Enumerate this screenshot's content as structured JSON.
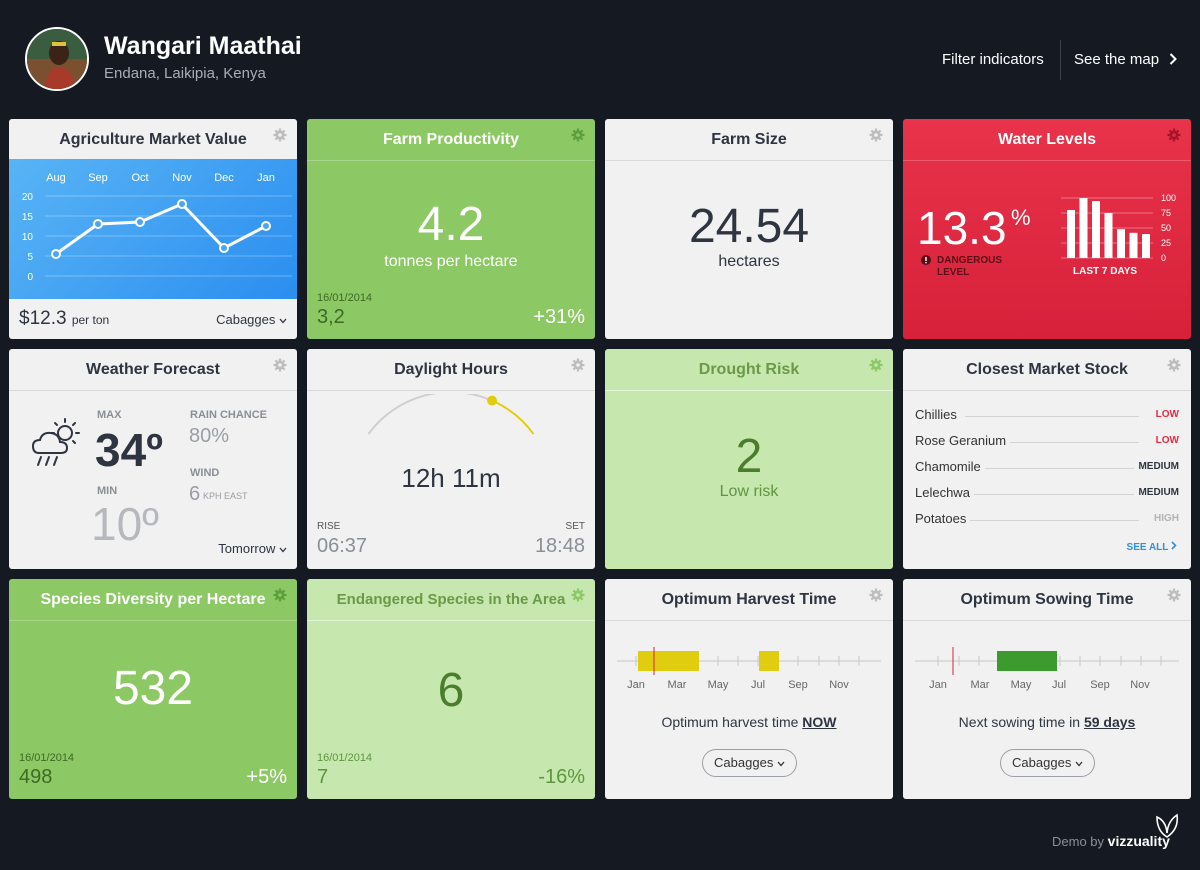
{
  "user": {
    "name": "Wangari Maathai",
    "location": "Endana, Laikipia, Kenya"
  },
  "nav": {
    "filter_label": "Filter indicators",
    "map_label": "See the map"
  },
  "cards": {
    "market_value": {
      "title": "Agriculture Market Value",
      "price": "$12.3",
      "unit": "per ton",
      "crop": "Cabagges",
      "chart_data": {
        "type": "line",
        "categories": [
          "Aug",
          "Sep",
          "Oct",
          "Nov",
          "Dec",
          "Jan"
        ],
        "values": [
          5.5,
          13,
          13.5,
          18,
          7,
          12.5
        ],
        "yticks": [
          "20",
          "15",
          "10",
          "5",
          "0"
        ],
        "ylim": [
          0,
          20
        ]
      }
    },
    "farm_productivity": {
      "title": "Farm Productivity",
      "value": "4.2",
      "unit": "tonnes per hectare",
      "date": "16/01/2014",
      "prev": "3,2",
      "change": "+31%"
    },
    "farm_size": {
      "title": "Farm Size",
      "value": "24.54",
      "unit": "hectares"
    },
    "water_levels": {
      "title": "Water Levels",
      "value": "13.3",
      "pct": "%",
      "warning": "DANGEROUS LEVEL",
      "chart_label": "LAST 7 DAYS",
      "chart_data": {
        "type": "bar",
        "values": [
          80,
          100,
          95,
          75,
          48,
          42,
          40
        ],
        "yticks": [
          "100",
          "75",
          "50",
          "25",
          "0"
        ],
        "ylim": [
          0,
          100
        ]
      }
    },
    "weather": {
      "title": "Weather Forecast",
      "max_label": "MAX",
      "max": "34º",
      "min_label": "MIN",
      "min": "10º",
      "rain_label": "RAIN CHANCE",
      "rain": "80%",
      "wind_label": "WIND",
      "wind_speed": "6",
      "wind_unit": "KPH EAST",
      "day": "Tomorrow"
    },
    "daylight": {
      "title": "Daylight Hours",
      "value": "12h 11m",
      "rise_label": "RISE",
      "rise": "06:37",
      "set_label": "SET",
      "set": "18:48",
      "progress": 0.72
    },
    "drought": {
      "title": "Drought Risk",
      "value": "2",
      "label": "Low risk"
    },
    "market_stock": {
      "title": "Closest Market Stock",
      "items": [
        {
          "name": "Chillies",
          "level": "LOW",
          "color": "#e02e44"
        },
        {
          "name": "Rose Geranium",
          "level": "LOW",
          "color": "#e02e44"
        },
        {
          "name": "Chamomile",
          "level": "MEDIUM",
          "color": "#2e3440"
        },
        {
          "name": "Lelechwa",
          "level": "MEDIUM",
          "color": "#2e3440"
        },
        {
          "name": "Potatoes",
          "level": "HIGH",
          "color": "#b3b3b3"
        }
      ],
      "see_all": "SEE ALL"
    },
    "species": {
      "title": "Species Diversity per Hectare",
      "value": "532",
      "date": "16/01/2014",
      "prev": "498",
      "change": "+5%"
    },
    "endangered": {
      "title": "Endangered Species in the Area",
      "value": "6",
      "date": "16/01/2014",
      "prev": "7",
      "change": "-16%"
    },
    "harvest": {
      "title": "Optimum Harvest Time",
      "months": [
        "Jan",
        "Mar",
        "May",
        "Jul",
        "Sep",
        "Nov"
      ],
      "text": "Optimum harvest time",
      "highlight": "NOW",
      "crop": "Cabagges",
      "color": "#e1cd10"
    },
    "sowing": {
      "title": "Optimum Sowing Time",
      "months": [
        "Jan",
        "Mar",
        "May",
        "Jul",
        "Sep",
        "Nov"
      ],
      "text": "Next sowing time in",
      "highlight": "59 days",
      "crop": "Cabagges",
      "color": "#3b9b2c"
    }
  },
  "footer": {
    "demo": "Demo by",
    "brand": "vizzuality"
  }
}
